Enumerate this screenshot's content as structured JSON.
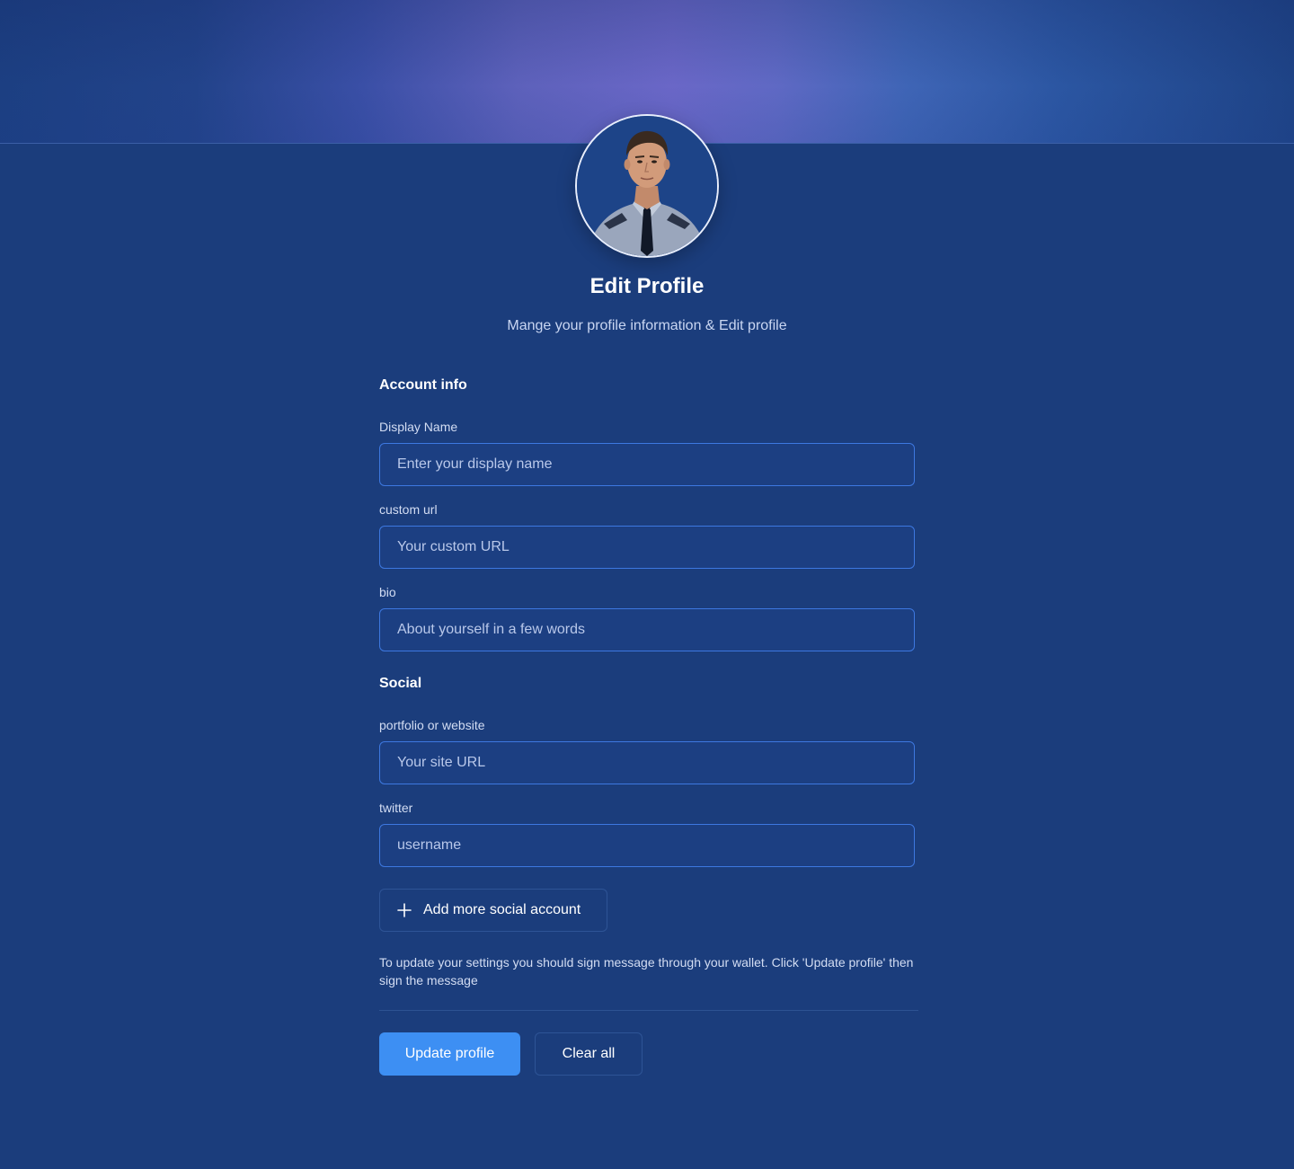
{
  "header": {
    "title": "Edit Profile",
    "subtitle": "Mange your profile information & Edit profile"
  },
  "avatar": {
    "icon": "profile-photo"
  },
  "account_info": {
    "heading": "Account info",
    "display_name": {
      "label": "Display Name",
      "value": "",
      "placeholder": "Enter your display name"
    },
    "custom_url": {
      "label": "custom url",
      "value": "",
      "placeholder": "Your custom URL"
    },
    "bio": {
      "label": "bio",
      "value": "",
      "placeholder": "About yourself in a few words"
    }
  },
  "social": {
    "heading": "Social",
    "portfolio": {
      "label": "portfolio or website",
      "value": "",
      "placeholder": "Your site URL"
    },
    "twitter": {
      "label": "twitter",
      "value": "",
      "placeholder": "username"
    },
    "add_more_label": "Add more social account"
  },
  "note": "To update your settings you should sign message through your wallet. Click 'Update profile' then sign the message",
  "actions": {
    "update_label": "Update profile",
    "clear_label": "Clear all"
  },
  "colors": {
    "background": "#1b3d7c",
    "input_border": "#3d78e0",
    "primary_button": "#3d8ff3"
  }
}
